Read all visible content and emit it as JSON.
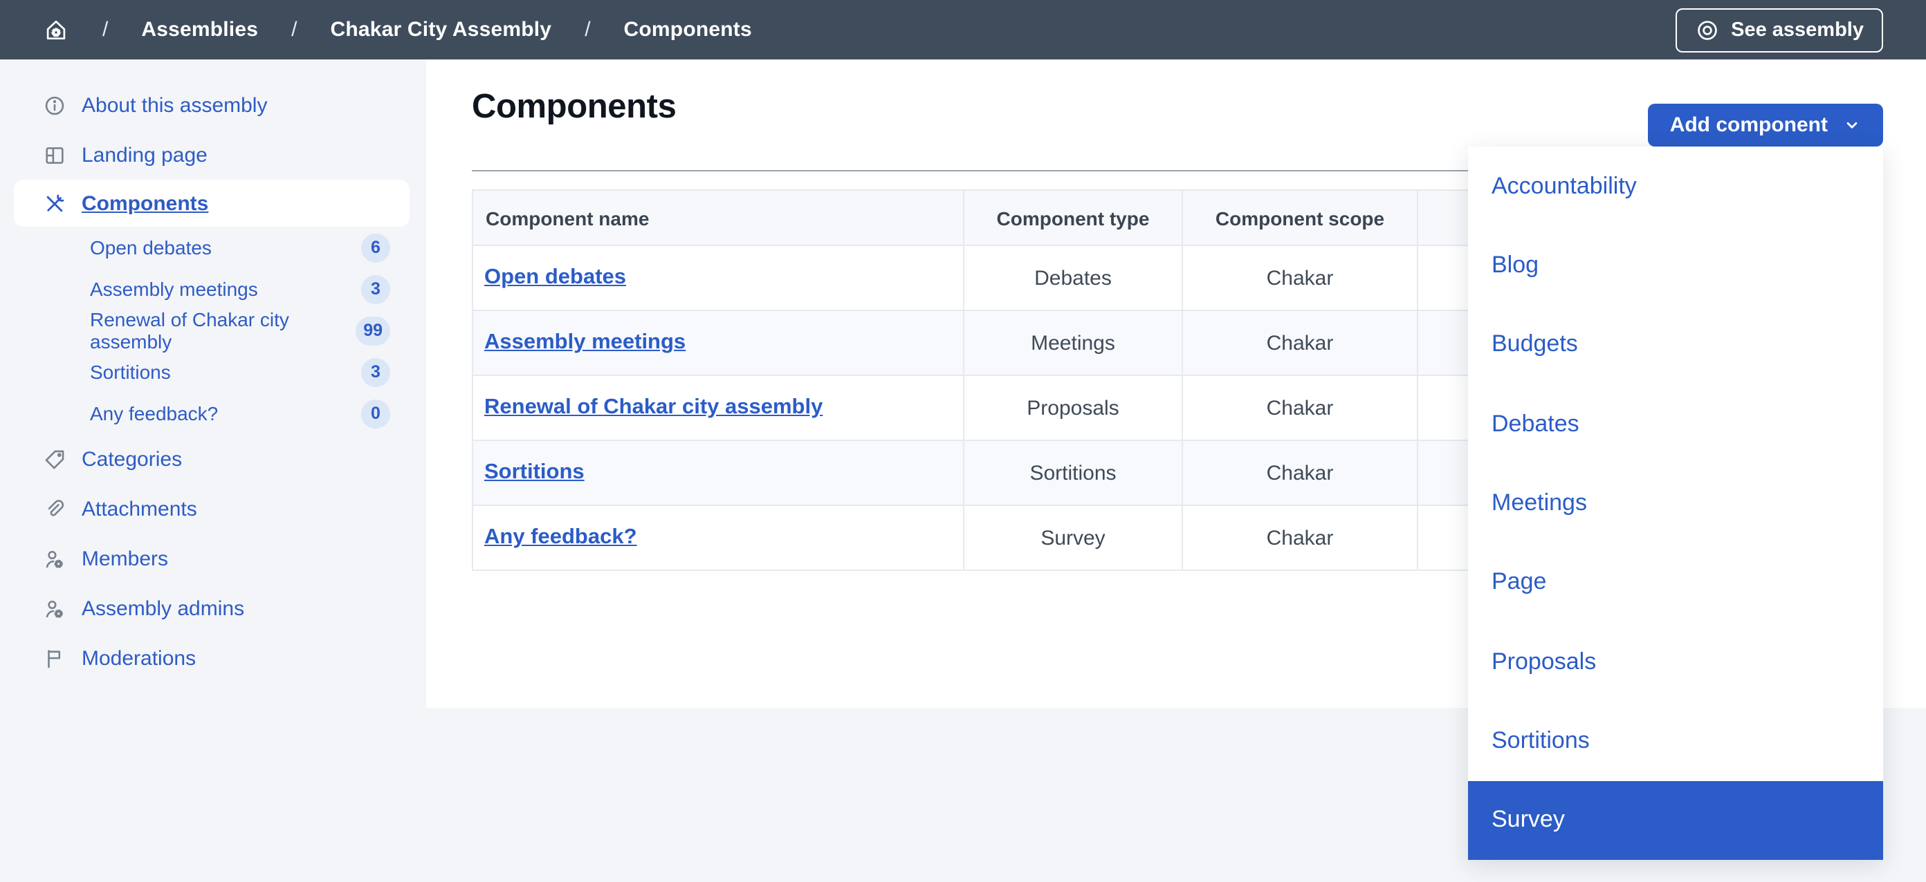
{
  "breadcrumb": {
    "separator": "/",
    "items": [
      "Assemblies",
      "Chakar City Assembly",
      "Components"
    ],
    "see_assembly_label": "See assembly"
  },
  "sidebar": {
    "items": [
      {
        "label": "About this assembly",
        "icon": "info-icon"
      },
      {
        "label": "Landing page",
        "icon": "layout-grid-icon"
      },
      {
        "label": "Components",
        "icon": "tools-icon",
        "active": true
      },
      {
        "label": "Categories",
        "icon": "tag-icon"
      },
      {
        "label": "Attachments",
        "icon": "paperclip-icon"
      },
      {
        "label": "Members",
        "icon": "user-gear-icon"
      },
      {
        "label": "Assembly admins",
        "icon": "user-gear-icon"
      },
      {
        "label": "Moderations",
        "icon": "flag-icon"
      }
    ],
    "sub_items": [
      {
        "label": "Open debates",
        "badge": "6"
      },
      {
        "label": "Assembly meetings",
        "badge": "3"
      },
      {
        "label": "Renewal of Chakar city assembly",
        "badge": "99"
      },
      {
        "label": "Sortitions",
        "badge": "3"
      },
      {
        "label": "Any feedback?",
        "badge": "0"
      }
    ]
  },
  "main": {
    "title": "Components",
    "add_component_label": "Add component",
    "table": {
      "headers": [
        "Component name",
        "Component type",
        "Component scope"
      ],
      "rows": [
        {
          "name": "Open debates",
          "type": "Debates",
          "scope": "Chakar"
        },
        {
          "name": "Assembly meetings",
          "type": "Meetings",
          "scope": "Chakar"
        },
        {
          "name": "Renewal of Chakar city assembly",
          "type": "Proposals",
          "scope": "Chakar"
        },
        {
          "name": "Sortitions",
          "type": "Sortitions",
          "scope": "Chakar"
        },
        {
          "name": "Any feedback?",
          "type": "Survey",
          "scope": "Chakar"
        }
      ]
    }
  },
  "dropdown": {
    "items": [
      "Accountability",
      "Blog",
      "Budgets",
      "Debates",
      "Meetings",
      "Page",
      "Proposals",
      "Sortitions",
      "Survey"
    ],
    "highlighted": "Survey"
  },
  "colors": {
    "primary": "#2b5cc7",
    "topbar": "#3f4c5c",
    "page_background": "#f3f5f8",
    "badge_background": "#dbe6f7",
    "table_border": "#e6e9ee"
  }
}
